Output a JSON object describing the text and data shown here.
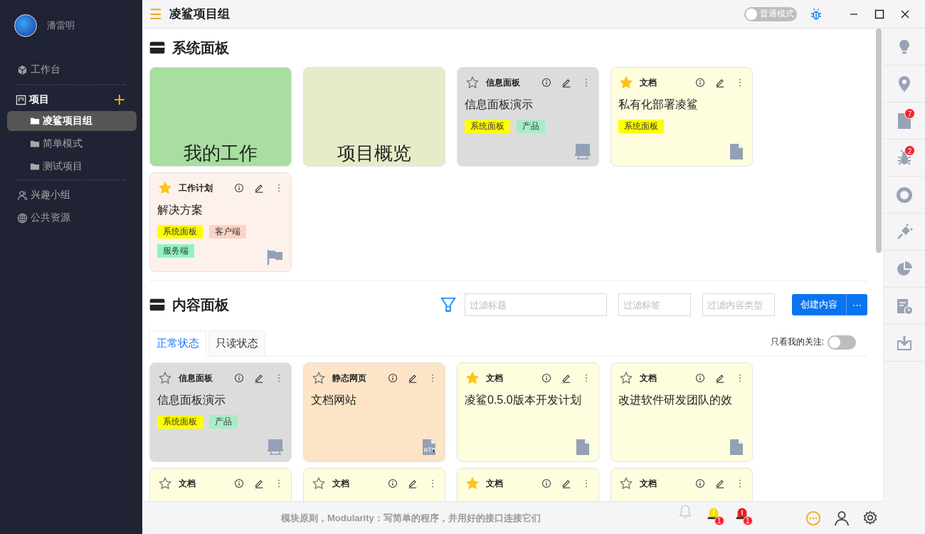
{
  "sidebar": {
    "user": {
      "name": "潘雷明"
    },
    "items": [
      {
        "label": "工作台",
        "kind": "workbench",
        "selected": false
      },
      {
        "label": "项目",
        "kind": "project",
        "selected": false,
        "add": "+",
        "children": [
          {
            "label": "凌鲨项目组",
            "selected": true
          },
          {
            "label": "简单模式",
            "selected": false
          },
          {
            "label": "测试项目",
            "selected": false
          }
        ]
      },
      {
        "label": "兴趣小组",
        "kind": "group",
        "selected": false
      },
      {
        "label": "公共资源",
        "kind": "public",
        "selected": false
      }
    ]
  },
  "header": {
    "menu": "☰",
    "title": "凌鲨项目组",
    "mode_toggle": {
      "label": "普通模式",
      "on": false
    }
  },
  "system_panel": {
    "title": "系统面板",
    "cards": [
      {
        "kind": "tile",
        "title": "我的工作",
        "color": "#a8dea0"
      },
      {
        "kind": "tile",
        "title": "项目概览",
        "color": "#e6ecc8"
      },
      {
        "kind": "dashboard",
        "color": "#dcdcdc",
        "starred": false,
        "type": "信息面板",
        "title": "信息面板演示",
        "tags": [
          {
            "label": "系统面板",
            "color": "#ffff00"
          },
          {
            "label": "产品",
            "color": "#a8ecc8"
          }
        ]
      },
      {
        "kind": "document",
        "color": "#fefdde",
        "starred": true,
        "type": "文档",
        "title": "私有化部署凌鲨",
        "tags": [
          {
            "label": "系统面板",
            "color": "#ffff00"
          }
        ]
      },
      {
        "kind": "plan",
        "color": "#fdf1ec",
        "starred": true,
        "type": "工作计划",
        "title": "解决方案",
        "tags": [
          {
            "label": "系统面板",
            "color": "#ffff00"
          },
          {
            "label": "客户端",
            "color": "#fcd4c4"
          },
          {
            "label": "服务端",
            "color": "#90f4c0"
          }
        ]
      }
    ]
  },
  "content_panel": {
    "title": "内容面板",
    "filters": [
      {
        "placeholder": "过滤标题"
      },
      {
        "placeholder": "过滤标签"
      },
      {
        "placeholder": "过滤内容类型"
      }
    ],
    "create_button": "创建内容",
    "more_button": "⋯",
    "tabs": [
      {
        "label": "正常状态",
        "selected": true
      },
      {
        "label": "只读状态",
        "selected": false
      }
    ],
    "follow_toggle": {
      "label": "只看我的关注:",
      "on": false
    },
    "cards": [
      {
        "kind": "dashboard",
        "color": "#dcdcdc",
        "starred": false,
        "type": "信息面板",
        "title": "信息面板演示",
        "tags": [
          {
            "label": "系统面板",
            "color": "#ffff00"
          },
          {
            "label": "产品",
            "color": "#a8ecc8"
          }
        ]
      },
      {
        "kind": "webpage",
        "color": "#fde4c6",
        "starred": false,
        "type": "静态网页",
        "title": "文档网站"
      },
      {
        "kind": "document",
        "color": "#fefdde",
        "starred": true,
        "type": "文档",
        "title": "凌鲨0.5.0版本开发计划"
      },
      {
        "kind": "document",
        "color": "#fefdde",
        "starred": false,
        "type": "文档",
        "title": "改进软件研发团队的效"
      },
      {
        "kind": "document",
        "color": "#fefdde",
        "starred": false,
        "type": "文档"
      },
      {
        "kind": "document",
        "color": "#fefdde",
        "starred": false,
        "type": "文档"
      },
      {
        "kind": "document",
        "color": "#fefdde",
        "starred": true,
        "type": "文档"
      },
      {
        "kind": "document",
        "color": "#fefdde",
        "starred": false,
        "type": "文档"
      }
    ]
  },
  "rail": [
    {
      "kind": "bulb"
    },
    {
      "kind": "pin"
    },
    {
      "kind": "doc",
      "badge": "7"
    },
    {
      "kind": "bug",
      "badge": "2"
    },
    {
      "kind": "ring"
    },
    {
      "kind": "plug"
    },
    {
      "kind": "pie"
    },
    {
      "kind": "clockdoc"
    },
    {
      "kind": "download"
    }
  ],
  "footer": {
    "quote": "模块原则，Modularity：写简单的程序，并用好的接口连接它们",
    "alerts": [
      {
        "kind": "bell"
      },
      {
        "kind": "alarm",
        "color": "#f5e000",
        "badge": "1"
      },
      {
        "kind": "alarm",
        "color": "#e52020",
        "badge": "1"
      }
    ],
    "tools": [
      {
        "kind": "chat"
      },
      {
        "kind": "user"
      },
      {
        "kind": "gear"
      }
    ]
  }
}
